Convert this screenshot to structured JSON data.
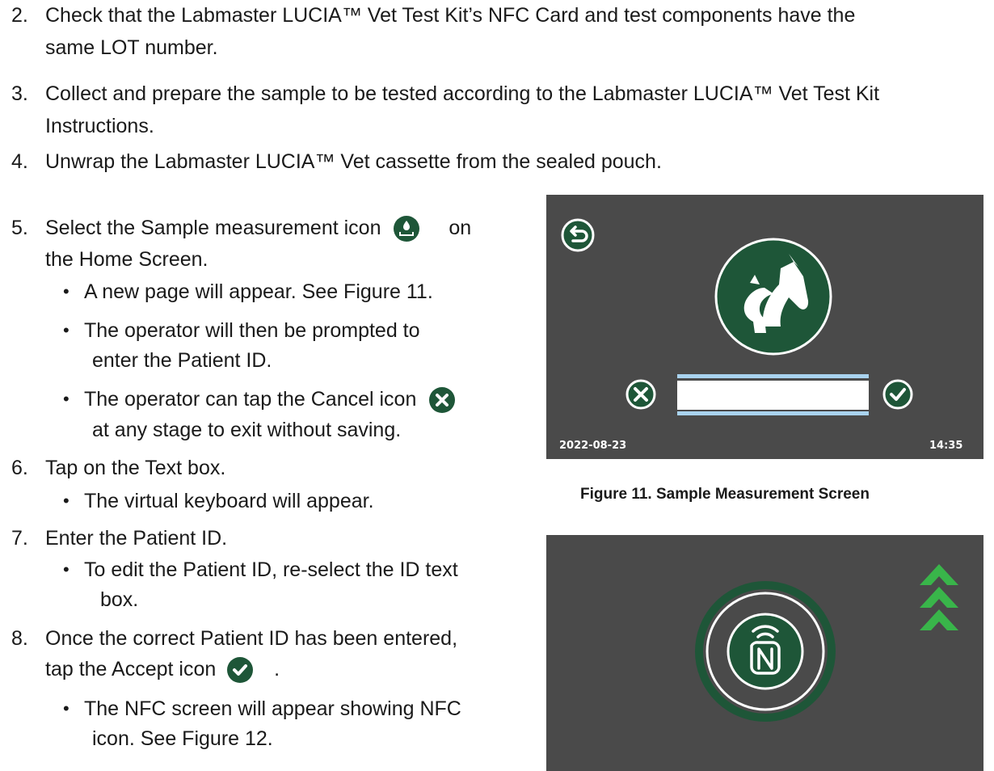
{
  "steps": {
    "s2": {
      "num": "2.",
      "line1": "Check that the Labmaster LUCIA™ Vet Test Kit’s NFC Card and test components have the",
      "line2": "same LOT  number."
    },
    "s3": {
      "num": "3.",
      "line1": "Collect and prepare the sample to be tested according to the Labmaster LUCIA™ Vet Test Kit",
      "line2": "Instructions."
    },
    "s4": {
      "num": "4.",
      "line1": "Unwrap the Labmaster LUCIA™ Vet cassette from the sealed pouch."
    },
    "s5": {
      "num": "5.",
      "line1_a": "Select the Sample measurement  icon",
      "line1_b": "on",
      "line2": "the Home Screen.",
      "b1": "A new page will appear. See Figure 11.",
      "b2_line1": "The operator will then be prompted to",
      "b2_line2": "enter the Patient ID.",
      "b3_line1": "The operator can tap the Cancel icon",
      "b3_line2": "at any stage to exit without saving."
    },
    "s6": {
      "num": "6.",
      "line1": "Tap on the Text box.",
      "b1": "The virtual keyboard will appear."
    },
    "s7": {
      "num": "7.",
      "line1": "Enter the Patient ID.",
      "b1_line1": "To edit the Patient ID, re-select the ID text",
      "b1_line2": "box."
    },
    "s8": {
      "num": "8.",
      "line1": "Once the correct Patient ID has been entered,",
      "line2_a": "tap the Accept icon",
      "line2_b": ".",
      "b1_line1": "The NFC screen will appear showing NFC",
      "b1_line2": "icon. See Figure 12."
    }
  },
  "bullet_char": "•",
  "figure11": {
    "date": "2022-08-23",
    "time": "14:35",
    "caption": "Figure 11. Sample Measurement Screen"
  },
  "colors": {
    "screen_bg": "#4a4a4a",
    "brand_green": "#1e5638",
    "input_blue": "#a9d3ef",
    "arrow_green": "#39b54a"
  },
  "icons": [
    "sample-measurement-icon",
    "cancel-icon",
    "accept-icon",
    "back-icon",
    "animal-logo-icon",
    "nfc-icon",
    "chevron-up-icon"
  ]
}
